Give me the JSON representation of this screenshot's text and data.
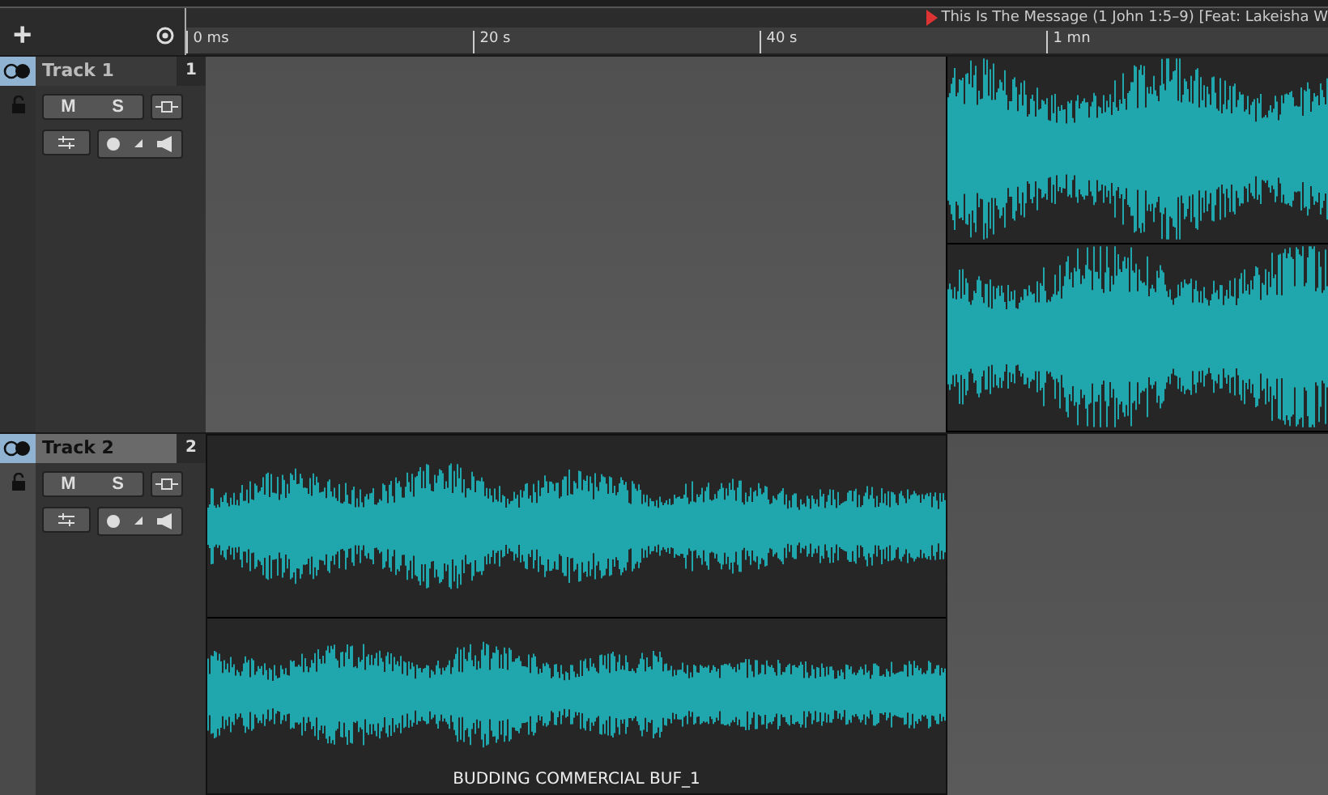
{
  "header": {
    "add_label": "+"
  },
  "ruler": {
    "clip_title": "This Is The Message (1 John 1:5–9) [Feat: Lakeisha W",
    "labels": [
      "0 ms",
      "20 s",
      "40 s",
      "1 mn"
    ]
  },
  "tracks": [
    {
      "name": "Track 1",
      "number": "1",
      "selected": false,
      "mute_label": "M",
      "solo_label": "S",
      "clip": {
        "kind": "late"
      }
    },
    {
      "name": "Track 2",
      "number": "2",
      "selected": true,
      "mute_label": "M",
      "solo_label": "S",
      "clip": {
        "kind": "early",
        "title": "BUDDING COMMERCIAL BUF_1"
      }
    }
  ]
}
